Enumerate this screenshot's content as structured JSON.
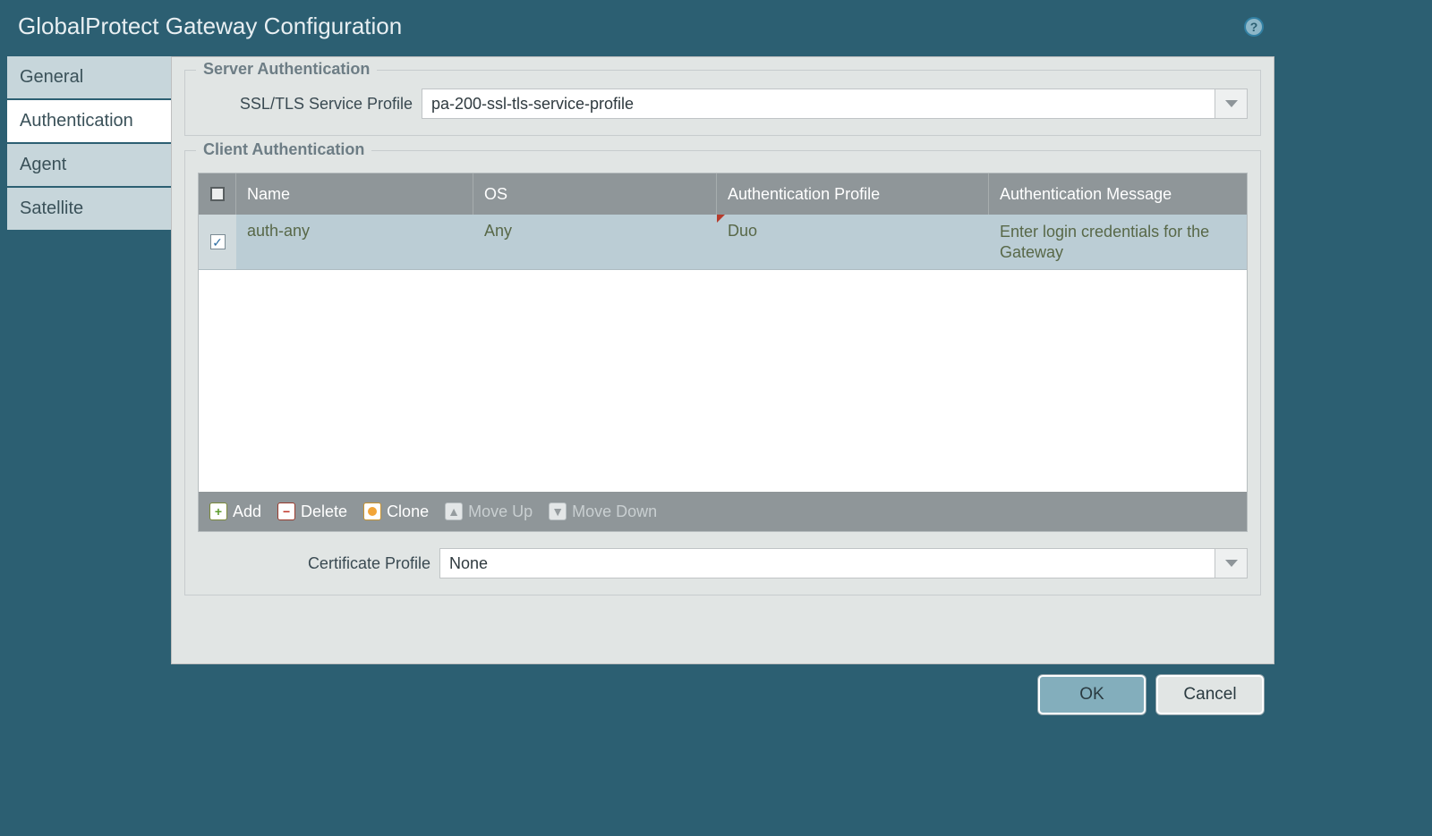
{
  "title": "GlobalProtect Gateway Configuration",
  "tabs": {
    "general": "General",
    "authentication": "Authentication",
    "agent": "Agent",
    "satellite": "Satellite"
  },
  "server_auth": {
    "legend": "Server Authentication",
    "ssl_label": "SSL/TLS Service Profile",
    "ssl_value": "pa-200-ssl-tls-service-profile"
  },
  "client_auth": {
    "legend": "Client Authentication",
    "columns": {
      "name": "Name",
      "os": "OS",
      "auth_profile": "Authentication Profile",
      "auth_message": "Authentication Message"
    },
    "rows": [
      {
        "checked": true,
        "name": "auth-any",
        "os": "Any",
        "auth_profile": "Duo",
        "auth_message": "Enter login credentials for the Gateway"
      }
    ],
    "toolbar": {
      "add": "Add",
      "delete": "Delete",
      "clone": "Clone",
      "move_up": "Move Up",
      "move_down": "Move Down"
    }
  },
  "cert_profile": {
    "label": "Certificate Profile",
    "value": "None"
  },
  "buttons": {
    "ok": "OK",
    "cancel": "Cancel"
  }
}
